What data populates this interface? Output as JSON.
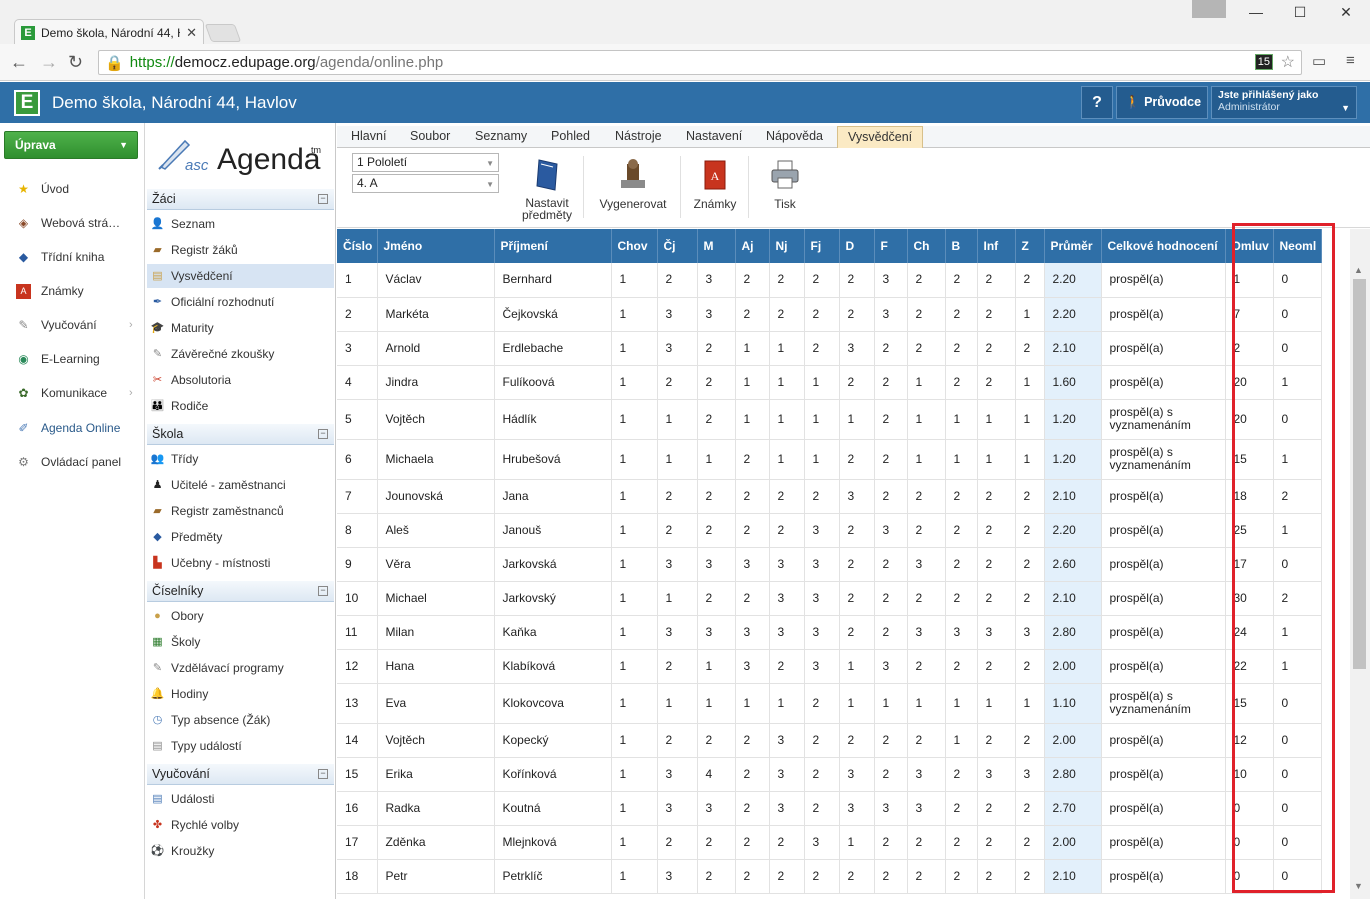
{
  "browser": {
    "tab_title": "Demo škola, Národní 44, H",
    "url_scheme": "https://",
    "url_host": "democz.edupage.org",
    "url_path": "/agenda/online.php",
    "ext_badge": "15"
  },
  "app": {
    "logo_letter": "E",
    "school_name": "Demo škola, Národní 44, Havlov",
    "help_label": "?",
    "guide_label": "Průvodce",
    "login_label": "Jste přihlášený jako",
    "login_user": "Administrátor"
  },
  "leftnav": {
    "uprava_label": "Úprava",
    "items": [
      {
        "label": "Úvod",
        "icon": "star-icon"
      },
      {
        "label": "Webová strá…",
        "icon": "web-icon"
      },
      {
        "label": "Třídní kniha",
        "icon": "book-icon"
      },
      {
        "label": "Známky",
        "icon": "grades-icon"
      },
      {
        "label": "Vyučování",
        "icon": "teaching-icon"
      },
      {
        "label": "E-Learning",
        "icon": "elearning-icon"
      },
      {
        "label": "Komunikace",
        "icon": "communication-icon"
      },
      {
        "label": "Agenda Online",
        "icon": "pen-icon"
      },
      {
        "label": "Ovládací panel",
        "icon": "control-panel-icon"
      }
    ]
  },
  "subnav": {
    "logo_asc": "asc",
    "logo_agenda": "Agenda",
    "logo_tm": "tm",
    "sections": {
      "zaci": {
        "title": "Žáci",
        "items": [
          "Seznam",
          "Registr žáků",
          "Vysvědčení",
          "Oficiální rozhodnutí",
          "Maturity",
          "Závěrečné zkoušky",
          "Absolutoria",
          "Rodiče"
        ]
      },
      "skola": {
        "title": "Škola",
        "items": [
          "Třídy",
          "Učitelé - zaměstnanci",
          "Registr zaměstnanců",
          "Předměty",
          "Učebny - místnosti"
        ]
      },
      "ciselniky": {
        "title": "Číselníky",
        "items": [
          "Obory",
          "Školy",
          "Vzdělávací programy",
          "Hodiny",
          "Typ absence (Žák)",
          "Typy událostí"
        ]
      },
      "vyucovani": {
        "title": "Vyučování",
        "items": [
          "Události",
          "Rychlé volby",
          "Kroužky"
        ]
      }
    }
  },
  "tabs": [
    "Hlavní",
    "Soubor",
    "Seznamy",
    "Pohled",
    "Nástroje",
    "Nastavení",
    "Nápověda",
    "Vysvědčení"
  ],
  "ribbon": {
    "period": "1 Pololetí",
    "class": "4. A",
    "btn_predmety_1": "Nastavit",
    "btn_predmety_2": "předměty",
    "btn_generate": "Vygenerovat",
    "btn_grades": "Známky",
    "btn_print": "Tisk"
  },
  "table": {
    "headers": [
      "Číslo",
      "Jméno",
      "Příjmení",
      "Chov",
      "Čj",
      "M",
      "Aj",
      "Nj",
      "Fj",
      "D",
      "F",
      "Ch",
      "B",
      "Inf",
      "Z",
      "Průměr",
      "Celkové hodnocení",
      "Omluv",
      "Neoml"
    ],
    "rows": [
      [
        "1",
        "Václav",
        "Bernhard",
        "1",
        "2",
        "3",
        "2",
        "2",
        "2",
        "2",
        "3",
        "2",
        "2",
        "2",
        "2",
        "2.20",
        "prospěl(a)",
        "1",
        "0"
      ],
      [
        "2",
        "Markéta",
        "Čejkovská",
        "1",
        "3",
        "3",
        "2",
        "2",
        "2",
        "2",
        "3",
        "2",
        "2",
        "2",
        "1",
        "2.20",
        "prospěl(a)",
        "7",
        "0"
      ],
      [
        "3",
        "Arnold",
        "Erdlebache",
        "1",
        "3",
        "2",
        "1",
        "1",
        "2",
        "3",
        "2",
        "2",
        "2",
        "2",
        "2",
        "2.10",
        "prospěl(a)",
        "2",
        "0"
      ],
      [
        "4",
        "Jindra",
        "Fulíkoová",
        "1",
        "2",
        "2",
        "1",
        "1",
        "1",
        "2",
        "2",
        "1",
        "2",
        "2",
        "1",
        "1.60",
        "prospěl(a)",
        "20",
        "1"
      ],
      [
        "5",
        "Vojtěch",
        "Hádlík",
        "1",
        "1",
        "2",
        "1",
        "1",
        "1",
        "1",
        "2",
        "1",
        "1",
        "1",
        "1",
        "1.20",
        "prospěl(a) s vyznamenáním",
        "20",
        "0"
      ],
      [
        "6",
        "Michaela",
        "Hrubešová",
        "1",
        "1",
        "1",
        "2",
        "1",
        "1",
        "2",
        "2",
        "1",
        "1",
        "1",
        "1",
        "1.20",
        "prospěl(a) s vyznamenáním",
        "15",
        "1"
      ],
      [
        "7",
        "Jounovská",
        "Jana",
        "1",
        "2",
        "2",
        "2",
        "2",
        "2",
        "3",
        "2",
        "2",
        "2",
        "2",
        "2",
        "2.10",
        "prospěl(a)",
        "18",
        "2"
      ],
      [
        "8",
        "Aleš",
        "Janouš",
        "1",
        "2",
        "2",
        "2",
        "2",
        "3",
        "2",
        "3",
        "2",
        "2",
        "2",
        "2",
        "2.20",
        "prospěl(a)",
        "25",
        "1"
      ],
      [
        "9",
        "Věra",
        "Jarkovská",
        "1",
        "3",
        "3",
        "3",
        "3",
        "3",
        "2",
        "2",
        "3",
        "2",
        "2",
        "2",
        "2.60",
        "prospěl(a)",
        "17",
        "0"
      ],
      [
        "10",
        "Michael",
        "Jarkovský",
        "1",
        "1",
        "2",
        "2",
        "3",
        "3",
        "2",
        "2",
        "2",
        "2",
        "2",
        "2",
        "2.10",
        "prospěl(a)",
        "30",
        "2"
      ],
      [
        "11",
        "Milan",
        "Kaňka",
        "1",
        "3",
        "3",
        "3",
        "3",
        "3",
        "2",
        "2",
        "3",
        "3",
        "3",
        "3",
        "2.80",
        "prospěl(a)",
        "24",
        "1"
      ],
      [
        "12",
        "Hana",
        "Klabíková",
        "1",
        "2",
        "1",
        "3",
        "2",
        "3",
        "1",
        "3",
        "2",
        "2",
        "2",
        "2",
        "2.00",
        "prospěl(a)",
        "22",
        "1"
      ],
      [
        "13",
        "Eva",
        "Klokovcova",
        "1",
        "1",
        "1",
        "1",
        "1",
        "2",
        "1",
        "1",
        "1",
        "1",
        "1",
        "1",
        "1.10",
        "prospěl(a) s vyznamenáním",
        "15",
        "0"
      ],
      [
        "14",
        "Vojtěch",
        "Kopecký",
        "1",
        "2",
        "2",
        "2",
        "3",
        "2",
        "2",
        "2",
        "2",
        "1",
        "2",
        "2",
        "2.00",
        "prospěl(a)",
        "12",
        "0"
      ],
      [
        "15",
        "Erika",
        "Kořínková",
        "1",
        "3",
        "4",
        "2",
        "3",
        "2",
        "3",
        "2",
        "3",
        "2",
        "3",
        "3",
        "2.80",
        "prospěl(a)",
        "10",
        "0"
      ],
      [
        "16",
        "Radka",
        "Koutná",
        "1",
        "3",
        "3",
        "2",
        "3",
        "2",
        "3",
        "3",
        "3",
        "2",
        "2",
        "2",
        "2.70",
        "prospěl(a)",
        "0",
        "0"
      ],
      [
        "17",
        "Zděnka",
        "Mlejnková",
        "1",
        "2",
        "2",
        "2",
        "2",
        "3",
        "1",
        "2",
        "2",
        "2",
        "2",
        "2",
        "2.00",
        "prospěl(a)",
        "0",
        "0"
      ],
      [
        "18",
        "Petr",
        "Petrklíč",
        "1",
        "3",
        "2",
        "2",
        "2",
        "2",
        "2",
        "2",
        "2",
        "2",
        "2",
        "2",
        "2.10",
        "prospěl(a)",
        "0",
        "0"
      ]
    ]
  },
  "colors": {
    "header_blue": "#2f6fa7",
    "green": "#3a9a3c",
    "highlight": "#e0212a"
  }
}
